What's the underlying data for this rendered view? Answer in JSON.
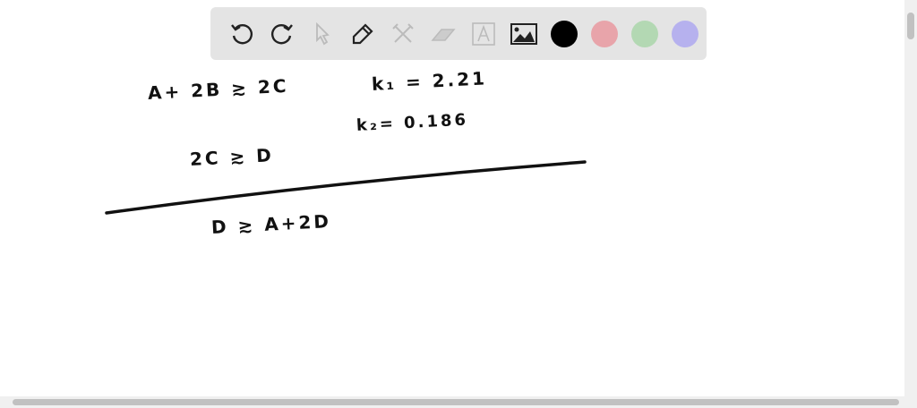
{
  "toolbar": {
    "tools": [
      "undo-icon",
      "redo-icon",
      "select-icon",
      "pen-icon",
      "tools-icon",
      "eraser-icon",
      "text-icon",
      "image-icon"
    ],
    "colors": [
      "#000000",
      "#e8a4aa",
      "#b3d8b3",
      "#b6b1ee"
    ]
  },
  "canvas": {
    "line1": "A+ 2B ≳ 2C",
    "k1": "k₁ = 2.21",
    "line2": "2C ≳ D",
    "k2": "k₂= 0.186",
    "line3": "D ≳ A+2D"
  }
}
